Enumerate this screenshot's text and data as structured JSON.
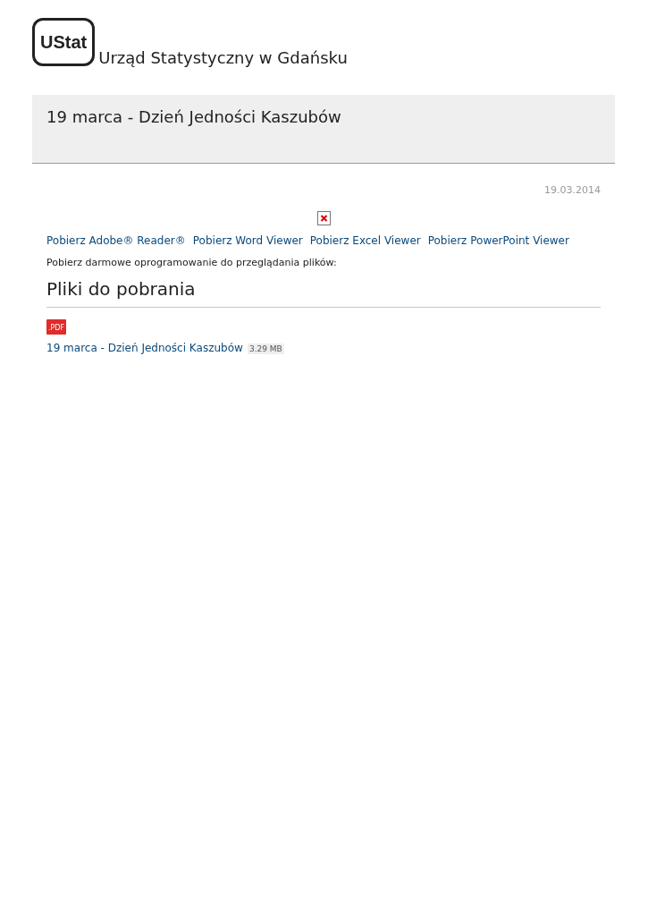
{
  "header": {
    "logo_text": "UStat",
    "site_name": "Urząd Statystyczny w Gdańsku"
  },
  "article": {
    "title": "19 marca - Dzień Jedności Kaszubów",
    "date": "19.03.2014",
    "download_links": [
      "Pobierz Adobe® Reader®",
      "Pobierz Word Viewer",
      "Pobierz Excel Viewer",
      "Pobierz PowerPoint Viewer"
    ],
    "download_note": "Pobierz darmowe oprogramowanie do przeglądania plików:"
  },
  "files": {
    "heading": "Pliki do pobrania",
    "items": [
      {
        "type_label": ".PDF",
        "name": "19 marca - Dzień Jedności Kaszubów",
        "size": "3.29 MB"
      }
    ]
  }
}
